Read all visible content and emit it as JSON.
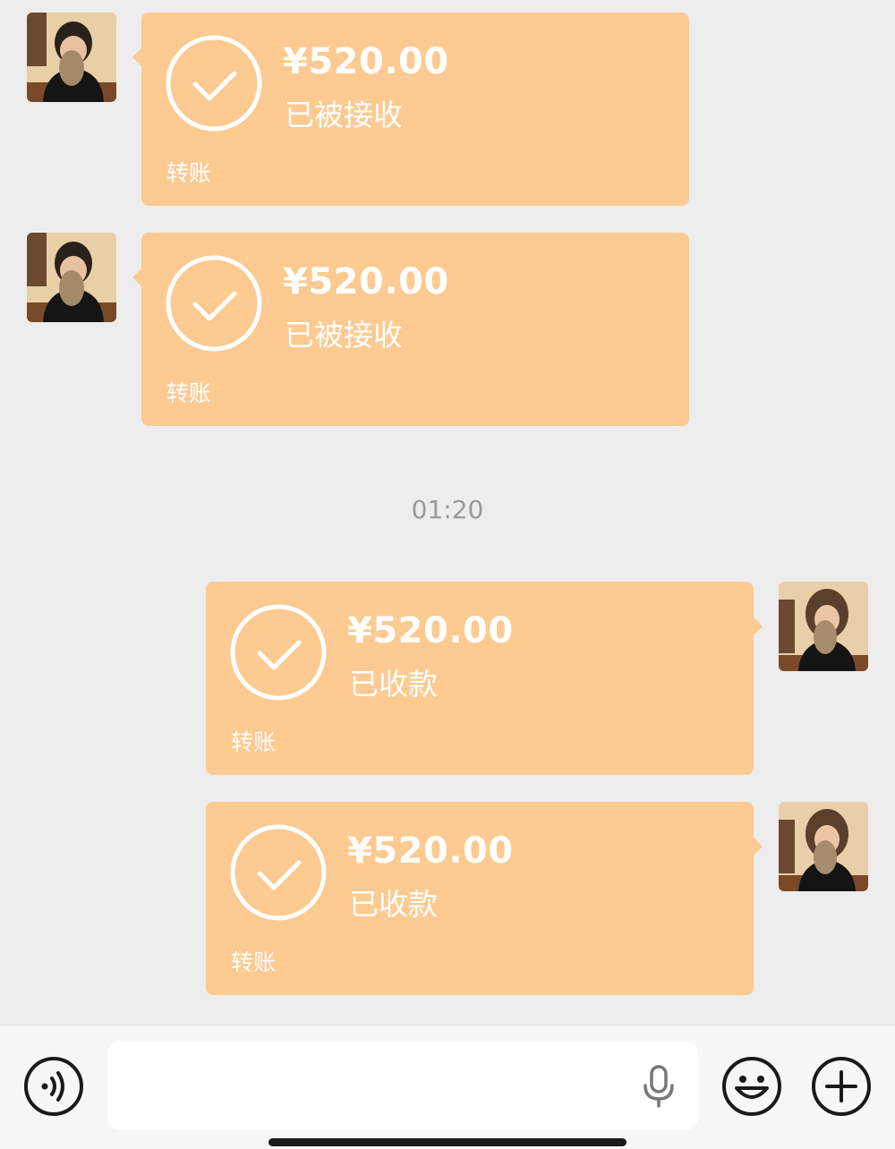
{
  "messages": [
    {
      "side": "left",
      "amount": "¥520.00",
      "status": "已被接收",
      "label": "转账"
    },
    {
      "side": "left",
      "amount": "¥520.00",
      "status": "已被接收",
      "label": "转账"
    },
    {
      "side": "right",
      "amount": "¥520.00",
      "status": "已收款",
      "label": "转账"
    },
    {
      "side": "right",
      "amount": "¥520.00",
      "status": "已收款",
      "label": "转账"
    }
  ],
  "timestamp": "01:20",
  "input": {
    "value": "",
    "placeholder": ""
  },
  "colors": {
    "bubble": "#fdca91",
    "background": "#ededed",
    "toolbar": "#f7f7f7"
  },
  "icons": {
    "voice": "voice-mode-icon",
    "mic": "microphone-icon",
    "emoji": "emoji-icon",
    "more": "plus-icon"
  }
}
